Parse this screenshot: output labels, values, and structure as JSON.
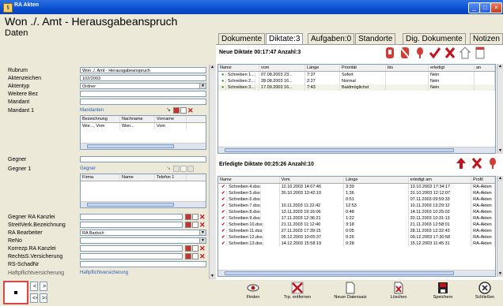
{
  "window": {
    "title": "RA Akten",
    "min": "_",
    "max": "□",
    "close": "×"
  },
  "header": {
    "title": "Won ./. Amt - Herausgabeanspruch",
    "subtitle": "Daten"
  },
  "form": {
    "rubrum_label": "Rubrum",
    "rubrum_value": "Won ./. Amt                 - Herausgabeanspruch",
    "aktenzeichen_label": "Aktenzeichen",
    "aktenzeichen_value": "102/2003",
    "aktentyp_label": "Aktentyp",
    "aktentyp_value": "Ordner",
    "weitere_label": "Weitere Bez",
    "mandant_label": "Mandant",
    "mandant1_label": "Mandant 1",
    "mandanten_sub": "Mandanten",
    "mandanten_cols": [
      "Bezeichnung",
      "Nachname",
      "Vorname"
    ],
    "mandanten_row": [
      "Wor..., Vom",
      "Won...",
      "Vom"
    ],
    "gegner_label": "Gegner",
    "gegner1_label": "Gegner 1",
    "gegner_sub": "Gegner",
    "gegner_cols": [
      "Firma",
      "Name",
      "Telefon 1"
    ],
    "gegner_ra_label": "Gegner RA Kanzlei",
    "streitverk_label": "StreitVerk.Bezeichnung",
    "rabearbeiter_label": "RA Bearbeiter",
    "rabearbeiter_value": "RA Bartsch",
    "reno_label": "ReNo",
    "korrezp_label": "Korrezp.RA Kanzlei",
    "rechtss_label": "RechtsS.Versicherung",
    "rs_label": "RS-SchadNr",
    "haft_label": "Haftpflichtversicherung",
    "haft_sub": "Haftpflichtversicherung"
  },
  "nav": {
    "prev": "<",
    "next": ">",
    "first": "<<",
    "last": ">>"
  },
  "tabs": [
    "Dokumente",
    "Diktate:3",
    "Aufgaben:0",
    "Standorte",
    "Dig. Dokumente",
    "Notizen"
  ],
  "neue": {
    "title": "Neue Diktate 00:17:47 Anzahl:3",
    "cols": [
      "Name",
      "vom",
      "Länge",
      "Priorität",
      "bis",
      "erledigt",
      "an"
    ],
    "rows": [
      [
        "Schreiben 1...",
        "07.08.2003 23...",
        "7:37",
        "Sofort",
        "",
        "Nein",
        ""
      ],
      [
        "Schreiben 2...",
        "28.08.2003 16...",
        "2:27",
        "Normal",
        "",
        "Nein",
        ""
      ],
      [
        "Schreiben 3...",
        "17.09.2003 16...",
        "7:43",
        "Baldmöglichst",
        "",
        "Nein",
        ""
      ]
    ]
  },
  "erledigte": {
    "title": "Erledigte Diktate 00:25:26 Anzahl:10",
    "cols": [
      "Name",
      "Vom",
      "Länge",
      "erledigt am",
      "Profil"
    ],
    "rows": [
      [
        "Schreiben 4.dss",
        "12.10.2003 14:07:46",
        "3:39",
        "13.10.2003 17:34:17",
        "RA-Akten"
      ],
      [
        "Schreiben 5.dss",
        "30.10.2003 13:42:10",
        "1:36",
        "31.10.2003 12:12:07",
        "RA-Akten"
      ],
      [
        "Schreiben 6.dss",
        "",
        "0:51",
        "07.11.2003 09:59:33",
        "RA-Akten"
      ],
      [
        "Schreiben 7.dss",
        "10.11.2003 11:22:42",
        "12:53",
        "10.11.2003 13:29:12",
        "RA-Akten"
      ],
      [
        "Schreiben 8.dss",
        "13.11.2003 19:16:06",
        "0:48",
        "14.11.2003 10:25:03",
        "RA-Akten"
      ],
      [
        "Schreiben 9.dss",
        "17.11.2003 12:36:21",
        "1:22",
        "20.11.2003 10:31:13",
        "RA-Akten"
      ],
      [
        "Schreiben 10.dss",
        "21.11.2003 11:12:40",
        "3:18",
        "21.11.2003 12:58:01",
        "RA-Akten"
      ],
      [
        "Schreiben 11.dss",
        "27.11.2003 17:39:15",
        "0:05",
        "28.11.2003 12:32:43",
        "RA-Akten"
      ],
      [
        "Schreiben 12.dss",
        "05.12.2003 10:05:37",
        "0:26",
        "09.12.2003 17:30:58",
        "RA-Akten"
      ],
      [
        "Schreiben 13.dss",
        "14.12.2003 15:58:19",
        "0:28",
        "15.12.2003 11:45:31",
        "RA-Akten"
      ]
    ]
  },
  "toolbar": {
    "finden": "Finden",
    "trp": "Trp. entfernen",
    "neue_datensatz": "Neuer Datensatz",
    "loeschen": "Löschen",
    "speichern": "Speichern",
    "schliessen": "Schließen"
  },
  "colors": {
    "titlebar": "#0a4fd1",
    "accent_red": "#c0141c",
    "link_blue": "#2d5bbd"
  }
}
